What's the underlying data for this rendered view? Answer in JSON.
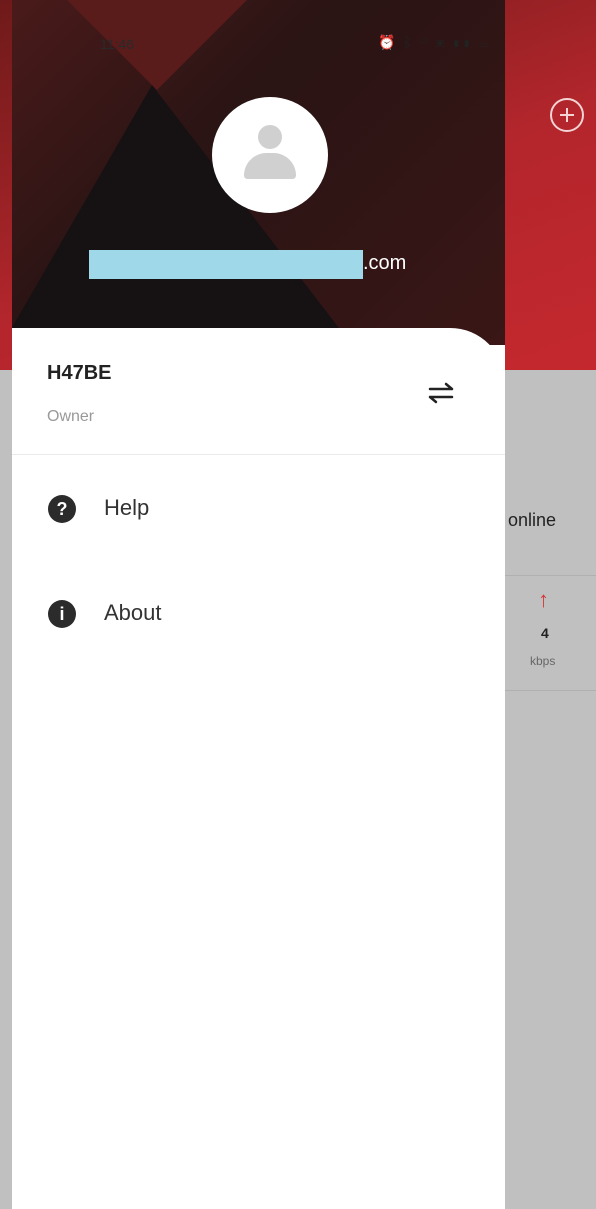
{
  "status_bar": {
    "time": "11:46",
    "icons": "⏰ ᛒ ⌔ ▣ ▮▮ ▭",
    "battery": "85"
  },
  "drawer": {
    "email_suffix": ".com",
    "account": {
      "name": "H47BE",
      "role": "Owner"
    },
    "menu": [
      {
        "label": "Help",
        "icon": "?"
      },
      {
        "label": "About",
        "icon": "i"
      }
    ]
  },
  "background_app": {
    "status_text": "online",
    "upload_speed": "4",
    "upload_unit": "kbps"
  },
  "colors": {
    "header_red": "#b3262c",
    "header_dark": "#161113",
    "redaction": "#9fd8e8",
    "upload_arrow": "#d23a3a"
  }
}
